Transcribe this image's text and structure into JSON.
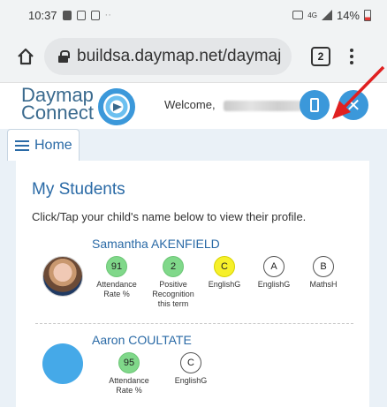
{
  "status_bar": {
    "time": "10:37",
    "dots": "··",
    "signal_label": "4G",
    "battery": "14%"
  },
  "browser": {
    "url": "buildsa.daymap.net/daymaj",
    "tab_count": "2"
  },
  "header": {
    "logo_line1": "Daymap",
    "logo_line2": "Connect",
    "welcome": "Welcome,",
    "close_label": "✕"
  },
  "nav": {
    "home_label": "Home"
  },
  "main": {
    "title": "My Students",
    "instructions": "Click/Tap your child's name below to view their profile."
  },
  "students": [
    {
      "name": "Samantha AKENFIELD",
      "badges": [
        {
          "value": "91",
          "label": "Attendance Rate %"
        },
        {
          "value": "2",
          "label": "Positive Recognition this term"
        },
        {
          "value": "C",
          "label": "EnglishG"
        },
        {
          "value": "A",
          "label": "EnglishG"
        },
        {
          "value": "B",
          "label": "MathsH"
        }
      ]
    },
    {
      "name": "Aaron COULTATE",
      "badges": [
        {
          "value": "95",
          "label": "Attendance Rate %"
        },
        {
          "value": "C",
          "label": "EnglishG"
        }
      ]
    }
  ],
  "colors": {
    "brand_blue": "#3b98da",
    "title_blue": "#2a6aa6",
    "badge_green": "#80d88a",
    "badge_yellow": "#f6f02a",
    "arrow_red": "#e02020"
  }
}
